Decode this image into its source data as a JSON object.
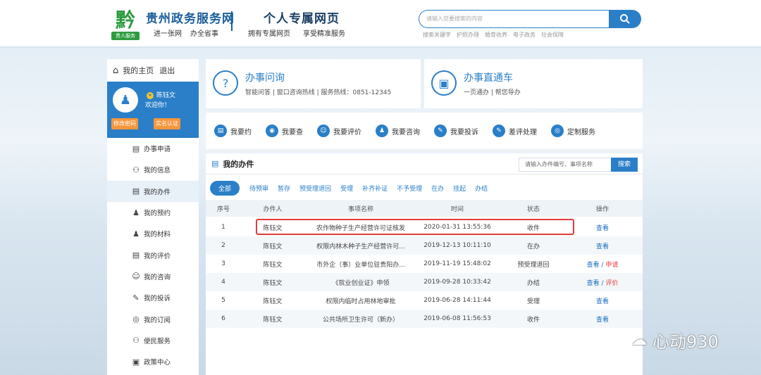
{
  "header": {
    "logo_glyph": "黔",
    "logo_tag": "贵人服务",
    "site_title": "贵州政务服务网",
    "site_sub": [
      "进一张网",
      "办全省事"
    ],
    "page_title": "个人专属网页",
    "page_sub": [
      "拥有专属网页",
      "享受精准服务"
    ],
    "search_placeholder": "请输入您要搜索的内容",
    "hot_words": [
      "搜索关键字",
      "护照办理",
      "婚育收养",
      "电子政务",
      "社会保障"
    ]
  },
  "sidebar": {
    "home_label": "我的主页",
    "logout_label": "退出",
    "user_name": "陈钰文",
    "welcome": "欢迎你！",
    "btn_edit": "修改密码",
    "btn_verify": "实名认证",
    "items": [
      {
        "label": "办事申请",
        "icon": "▤"
      },
      {
        "label": "我的信息",
        "icon": "⚇"
      },
      {
        "label": "我的办件",
        "icon": "▤"
      },
      {
        "label": "我的预约",
        "icon": "♟"
      },
      {
        "label": "我的材料",
        "icon": "♟"
      },
      {
        "label": "我的评价",
        "icon": "▤"
      },
      {
        "label": "我的咨询",
        "icon": "☺"
      },
      {
        "label": "我的投诉",
        "icon": "✎"
      },
      {
        "label": "我的订阅",
        "icon": "◎"
      },
      {
        "label": "便民服务",
        "icon": "⚇"
      },
      {
        "label": "政策中心",
        "icon": "▣"
      }
    ]
  },
  "panel_a": {
    "title": "办事问询",
    "sub": "智能问答 | 窗口咨询热线 | 服务热线：0851-12345",
    "icon": "?"
  },
  "panel_b": {
    "title": "办事直通车",
    "sub": "一页通办 | 帮您导办",
    "icon": "▣"
  },
  "services": [
    {
      "label": "我要约",
      "icon": "▤"
    },
    {
      "label": "我要查",
      "icon": "◉"
    },
    {
      "label": "我要评价",
      "icon": "☺"
    },
    {
      "label": "我要咨询",
      "icon": "♟"
    },
    {
      "label": "我要投诉",
      "icon": "✎"
    },
    {
      "label": "差评处理",
      "icon": "✎"
    },
    {
      "label": "定制服务",
      "icon": "◎"
    }
  ],
  "myitems": {
    "title": "我的办件",
    "search_placeholder": "请输入办件编号、事项名称",
    "search_btn": "搜索",
    "tabs": [
      "全部",
      "待预审",
      "暂存",
      "预受理退回",
      "受理",
      "补齐补证",
      "不予受理",
      "在办",
      "挂起",
      "办结"
    ],
    "columns": [
      "序号",
      "办件人",
      "事项名称",
      "时间",
      "状态",
      "操作"
    ],
    "rows": [
      {
        "no": "1",
        "person": "陈钰文",
        "name": "农作物种子生产经营许可证核发",
        "time": "2020-01-31 13:55:36",
        "status": "收件",
        "op": "查看",
        "op2": ""
      },
      {
        "no": "2",
        "person": "陈钰文",
        "name": "权限内林木种子生产经营许可...",
        "time": "2019-12-13 10:11:10",
        "status": "在办",
        "op": "查看",
        "op2": ""
      },
      {
        "no": "3",
        "person": "陈钰文",
        "name": "市外企（事）业单位驻贵阳办...",
        "time": "2019-11-19 15:48:02",
        "status": "预受理退回",
        "op": "查看 /",
        "op2": "申请"
      },
      {
        "no": "4",
        "person": "陈钰文",
        "name": "《就业创业证》申领",
        "time": "2019-09-28 10:33:42",
        "status": "办结",
        "op": "查看 /",
        "op2": "评价"
      },
      {
        "no": "5",
        "person": "陈钰文",
        "name": "权限内临时占用林地审批",
        "time": "2019-06-28 14:11:44",
        "status": "受理",
        "op": "查看",
        "op2": ""
      },
      {
        "no": "6",
        "person": "陈钰文",
        "name": "公共场所卫生许可（新办）",
        "time": "2019-06-08 11:56:53",
        "status": "收件",
        "op": "查看",
        "op2": ""
      }
    ]
  },
  "watermark": "心动930"
}
